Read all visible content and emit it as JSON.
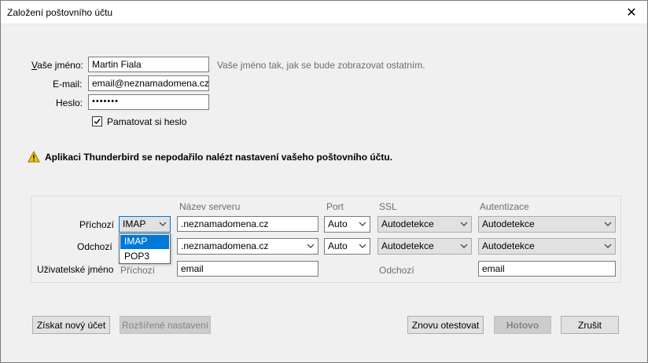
{
  "window": {
    "title": "Založení poštovního účtu",
    "close_glyph": "✕"
  },
  "identity": {
    "name_label": "Vaše jméno:",
    "name_value": "Martin Fiala",
    "name_hint": "Vaše jméno tak, jak se bude zobrazovat ostatním.",
    "email_label": "E-mail:",
    "email_value": "email@neznamadomena.cz",
    "password_label": "Heslo:",
    "password_value": "•••••••",
    "remember_label": "Pamatovat si heslo",
    "remember_checked": true
  },
  "warning": {
    "icon": "warning-triangle-icon",
    "text": "Aplikaci Thunderbird se nepodařilo nalézt nastavení vašeho poštovního účtu."
  },
  "server_table": {
    "headers": {
      "server": "Název serveru",
      "port": "Port",
      "ssl": "SSL",
      "auth": "Autentizace"
    },
    "incoming": {
      "label": "Příchozí",
      "protocol": "IMAP",
      "server": ".neznamadomena.cz",
      "port": "Auto",
      "ssl": "Autodetekce",
      "auth": "Autodetekce"
    },
    "outgoing": {
      "label": "Odchozí",
      "server": ".neznamadomena.cz",
      "port": "Auto",
      "ssl": "Autodetekce",
      "auth": "Autodetekce"
    },
    "username": {
      "label": "Uživatelské jméno",
      "incoming_label": "Příchozí",
      "incoming_value": "email",
      "outgoing_label": "Odchozí",
      "outgoing_value": "email"
    },
    "protocol_options": [
      "IMAP",
      "POP3"
    ],
    "protocol_selected": "IMAP"
  },
  "buttons": {
    "get_account": "Získat nový účet",
    "advanced": "Rozšířené nastavení",
    "retest": "Znovu otestovat",
    "done": "Hotovo",
    "cancel": "Zrušit"
  },
  "colors": {
    "accent": "#0078d7",
    "warning": "#f2c811"
  }
}
